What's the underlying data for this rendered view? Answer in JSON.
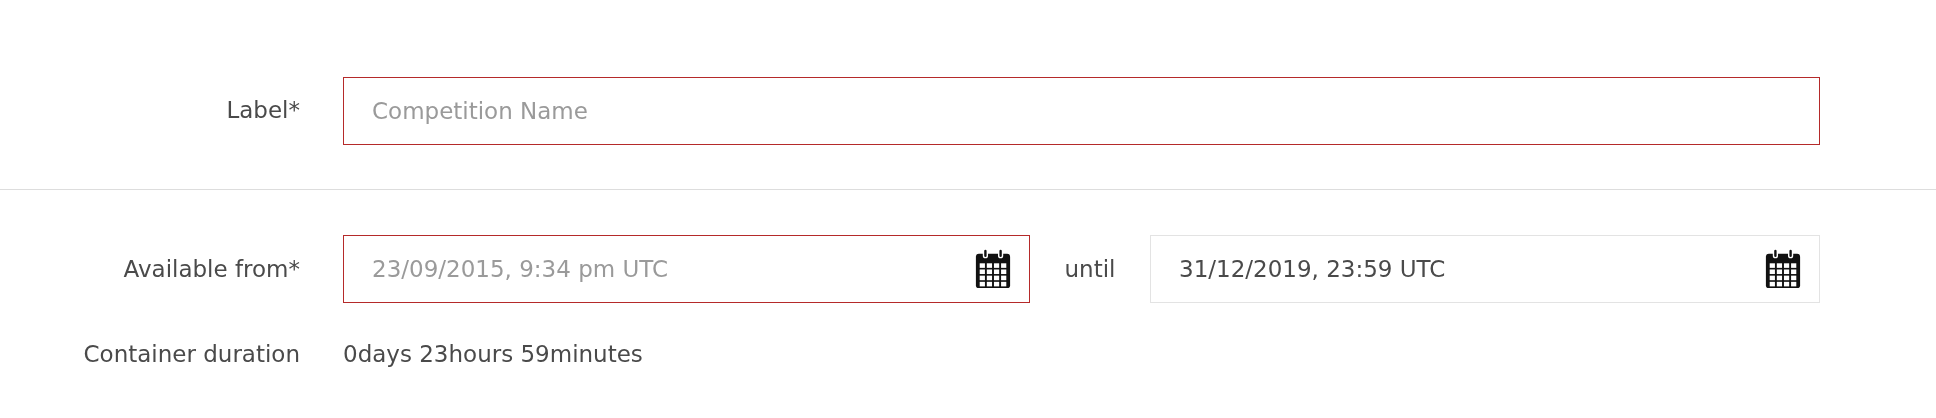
{
  "label_field": {
    "label": "Label*",
    "placeholder": "Competition Name",
    "invalid": true
  },
  "availability": {
    "label": "Available from*",
    "from": {
      "placeholder": "23/09/2015, 9:34 pm UTC",
      "invalid": true
    },
    "separator": "until",
    "until": {
      "value": "31/12/2019, 23:59 UTC",
      "invalid": false
    }
  },
  "duration": {
    "label": "Container duration",
    "value": "0days 23hours 59minutes"
  }
}
